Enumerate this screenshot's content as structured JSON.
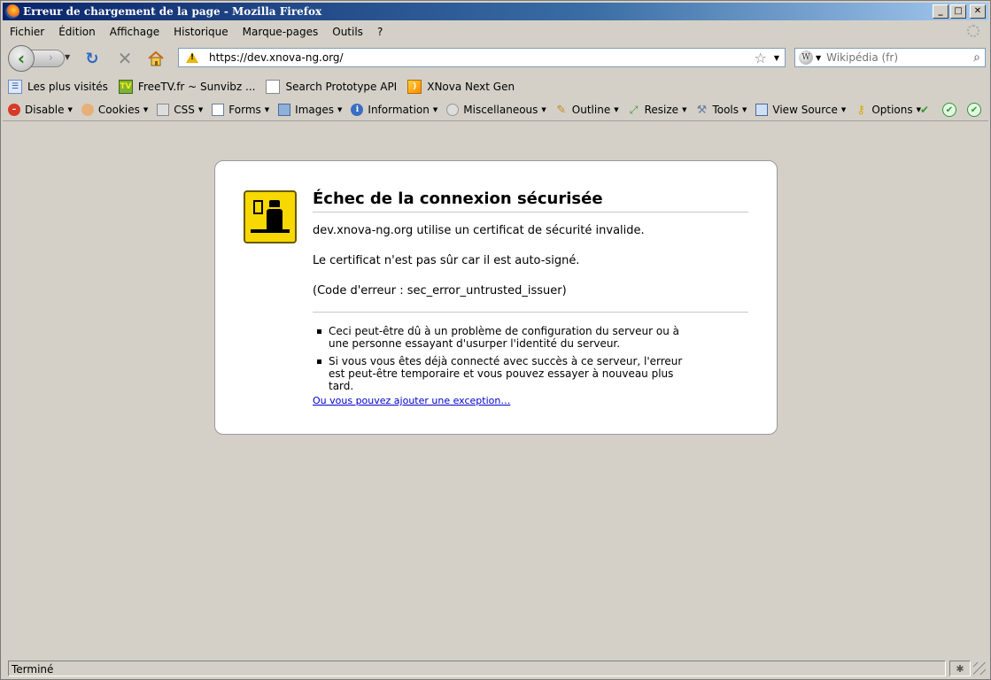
{
  "window": {
    "title": "Erreur de chargement de la page - Mozilla Firefox"
  },
  "menubar": {
    "items": [
      {
        "label": "Fichier"
      },
      {
        "label": "Édition"
      },
      {
        "label": "Affichage"
      },
      {
        "label": "Historique"
      },
      {
        "label": "Marque-pages"
      },
      {
        "label": "Outils"
      },
      {
        "label": "?"
      }
    ]
  },
  "navbar": {
    "url": "https://dev.xnova-ng.org/",
    "search_placeholder": "Wikipédia (fr)"
  },
  "bookmarks": {
    "items": [
      {
        "label": "Les plus visités",
        "icon": "most-visited-icon"
      },
      {
        "label": "FreeTV.fr ~ Sunvibz ...",
        "icon": "freetv-icon"
      },
      {
        "label": "Search Prototype API",
        "icon": "page-icon"
      },
      {
        "label": "XNova Next Gen",
        "icon": "rss-feed-icon"
      }
    ]
  },
  "devtoolbar": {
    "items": [
      {
        "label": "Disable",
        "icon": "disable-icon"
      },
      {
        "label": "Cookies",
        "icon": "cookies-icon"
      },
      {
        "label": "CSS",
        "icon": "css-icon"
      },
      {
        "label": "Forms",
        "icon": "forms-icon"
      },
      {
        "label": "Images",
        "icon": "images-icon"
      },
      {
        "label": "Information",
        "icon": "information-icon"
      },
      {
        "label": "Miscellaneous",
        "icon": "miscellaneous-icon"
      },
      {
        "label": "Outline",
        "icon": "outline-icon"
      },
      {
        "label": "Resize",
        "icon": "resize-icon"
      },
      {
        "label": "Tools",
        "icon": "tools-icon"
      },
      {
        "label": "View Source",
        "icon": "view-source-icon"
      },
      {
        "label": "Options",
        "icon": "options-icon"
      }
    ]
  },
  "error": {
    "title": "Échec de la connexion sécurisée",
    "line1": "dev.xnova-ng.org utilise un certificat de sécurité invalide.",
    "line2": "Le certificat n'est pas sûr car il est auto-signé.",
    "line3": "(Code d'erreur : sec_error_untrusted_issuer)",
    "bullets": [
      "Ceci peut-être dû à un problème de configuration du serveur ou à une personne essayant d'usurper l'identité du serveur.",
      "Si vous vous êtes déjà connecté avec succès à ce serveur, l'erreur est peut-être temporaire et vous pouvez essayer à nouveau plus tard."
    ],
    "exception_link": "Ou vous pouvez ajouter une exception…"
  },
  "statusbar": {
    "text": "Terminé"
  },
  "colors": {
    "chrome": "#d4d0c8",
    "titlebar": "#0a246a",
    "link": "#0000cc",
    "error_icon": "#f7d800"
  }
}
